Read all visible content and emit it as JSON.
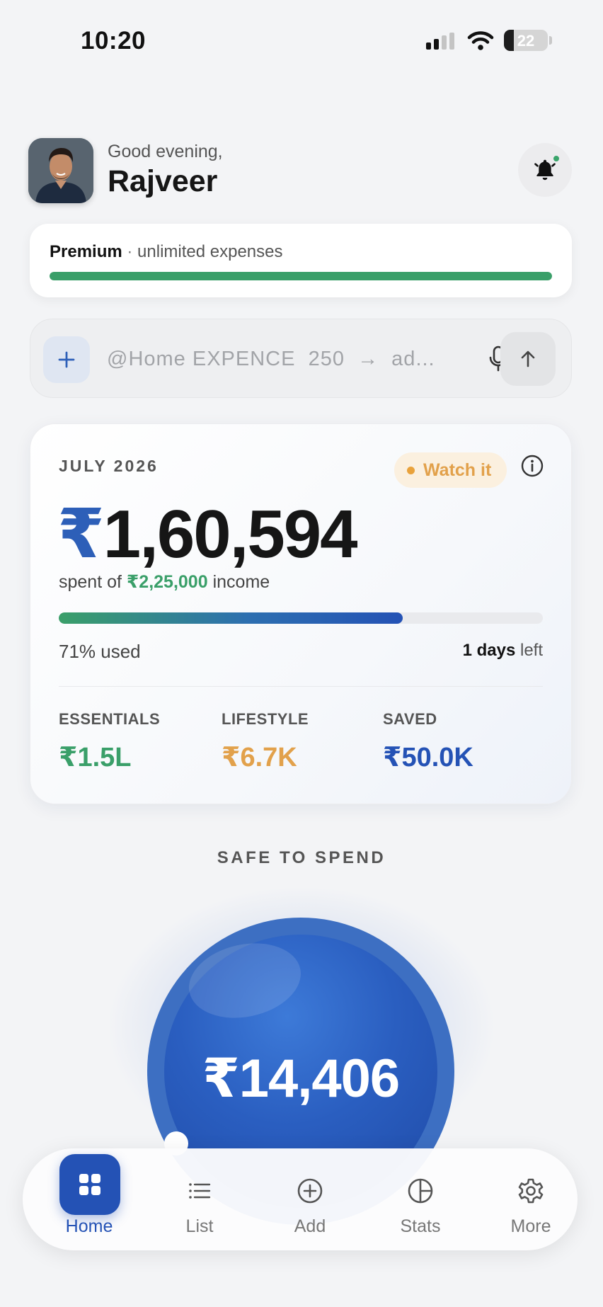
{
  "status_bar": {
    "time": "10:20",
    "battery": "22",
    "battery_level": 0.22
  },
  "header": {
    "greeting": "Good evening,",
    "name": "Rajveer",
    "avatar_icon": "user-photo",
    "bell_icon": "bell-icon",
    "notification_dot_color": "#3aa56b"
  },
  "premium": {
    "plan": "Premium",
    "separator": "·",
    "description": "unlimited expenses",
    "progress": 1.0,
    "bar_color": "#3a9f69"
  },
  "command": {
    "placeholder": "@Home EXPENCE  250  →  ad...",
    "add_icon": "plus-icon",
    "mic_icon": "microphone-icon",
    "send_icon": "arrow-up-icon"
  },
  "summary": {
    "month": "JULY 2026",
    "badge": "Watch it",
    "badge_color": "#e2a14b",
    "currency": "₹",
    "spent": "1,60,594",
    "spent_prefix": "spent of",
    "income": "₹2,25,000",
    "income_suffix": "income",
    "used_fraction": 0.71,
    "used_text": "71% used",
    "days_count": "1 days",
    "days_suffix": "left",
    "categories": [
      {
        "label": "ESSENTIALS",
        "value": "₹1.5L",
        "color": "#3a9f69"
      },
      {
        "label": "LIFESTYLE",
        "value": "₹6.7K",
        "color": "#e2a14b"
      },
      {
        "label": "SAVED",
        "value": "₹50.0K",
        "color": "#2452b5"
      }
    ]
  },
  "safe_to_spend": {
    "label": "SAFE TO SPEND",
    "amount": "₹14,406",
    "color": "#2452b5"
  },
  "nav": {
    "items": [
      {
        "label": "Home",
        "icon": "grid-icon",
        "active": true
      },
      {
        "label": "List",
        "icon": "list-icon",
        "active": false
      },
      {
        "label": "Add",
        "icon": "plus-circle-icon",
        "active": false
      },
      {
        "label": "Stats",
        "icon": "pie-chart-icon",
        "active": false
      },
      {
        "label": "More",
        "icon": "gear-icon",
        "active": false
      }
    ]
  }
}
